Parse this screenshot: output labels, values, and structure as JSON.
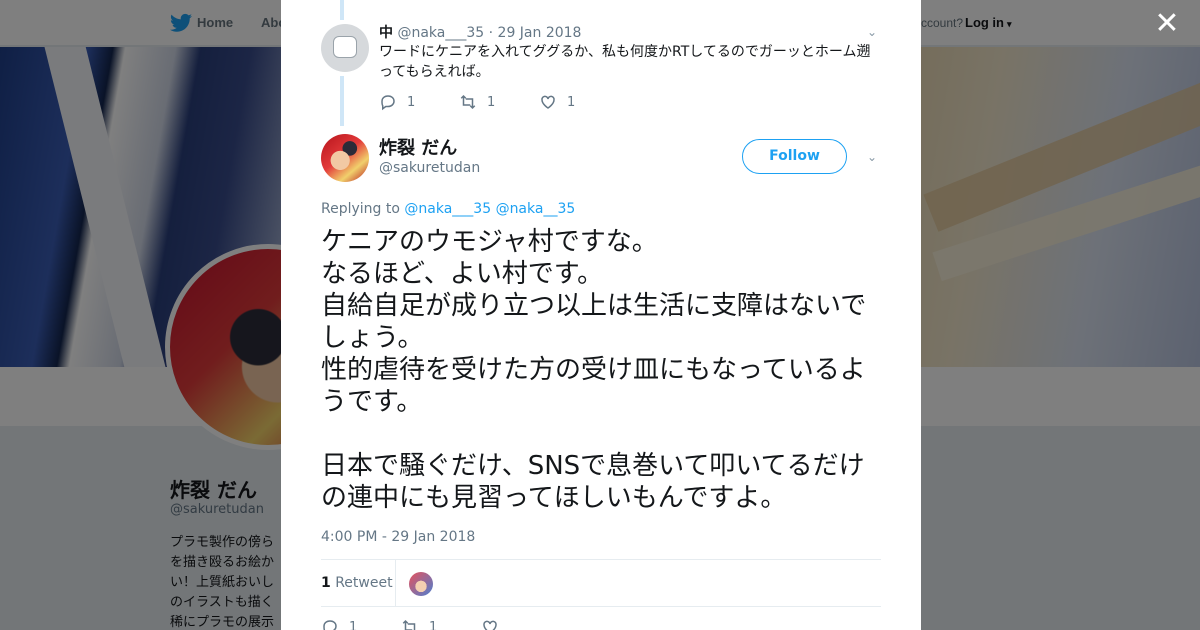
{
  "topbar": {
    "home_label": "Home",
    "about_label": "Abo",
    "account_prompt": "ccount?",
    "login_label": "Log in"
  },
  "profile": {
    "name": "炸裂 だん",
    "handle": "@sakuretudan",
    "bio_lines": [
      "プラモ製作の傍ら",
      "を描き殴るお絵か",
      "い！上質紙おいし",
      "のイラストも描く",
      "稀にプラモの展示"
    ]
  },
  "reply_tweet": {
    "name": "中",
    "handle": "@naka___35",
    "separator": "·",
    "date": "29 Jan 2018",
    "text": "ワードにケニアを入れてググるか、私も何度かRTしてるのでガーッとホーム遡ってもらえれば。",
    "reply_count": "1",
    "retweet_count": "1",
    "like_count": "1"
  },
  "main_tweet": {
    "name": "炸裂 だん",
    "handle": "@sakuretudan",
    "follow_label": "Follow",
    "replying_prefix": "Replying to",
    "replying_to": [
      "@naka___35",
      "@naka__35"
    ],
    "text": "ケニアのウモジャ村ですな。\nなるほど、よい村です。\n自給自足が成り立つ以上は生活に支障はないでしょう。\n性的虐待を受けた方の受け皿にもなっているようです。\n\n日本で騒ぐだけ、SNSで息巻いて叩いてるだけの連中にも見習ってほしいもんですよ。",
    "timestamp": "4:00 PM - 29 Jan 2018",
    "retweet_count": "1",
    "retweet_label": "Retweet",
    "reply_count": "1",
    "retweet_action_count": "1"
  },
  "colors": {
    "accent": "#1da1f2",
    "muted": "#657786",
    "text": "#14171a",
    "thread_line": "#cfe6f7"
  },
  "icons": [
    "twitter-bird-icon",
    "close-icon",
    "chevron-down-icon",
    "reply-icon",
    "retweet-icon",
    "heart-icon",
    "caret-down-icon"
  ]
}
